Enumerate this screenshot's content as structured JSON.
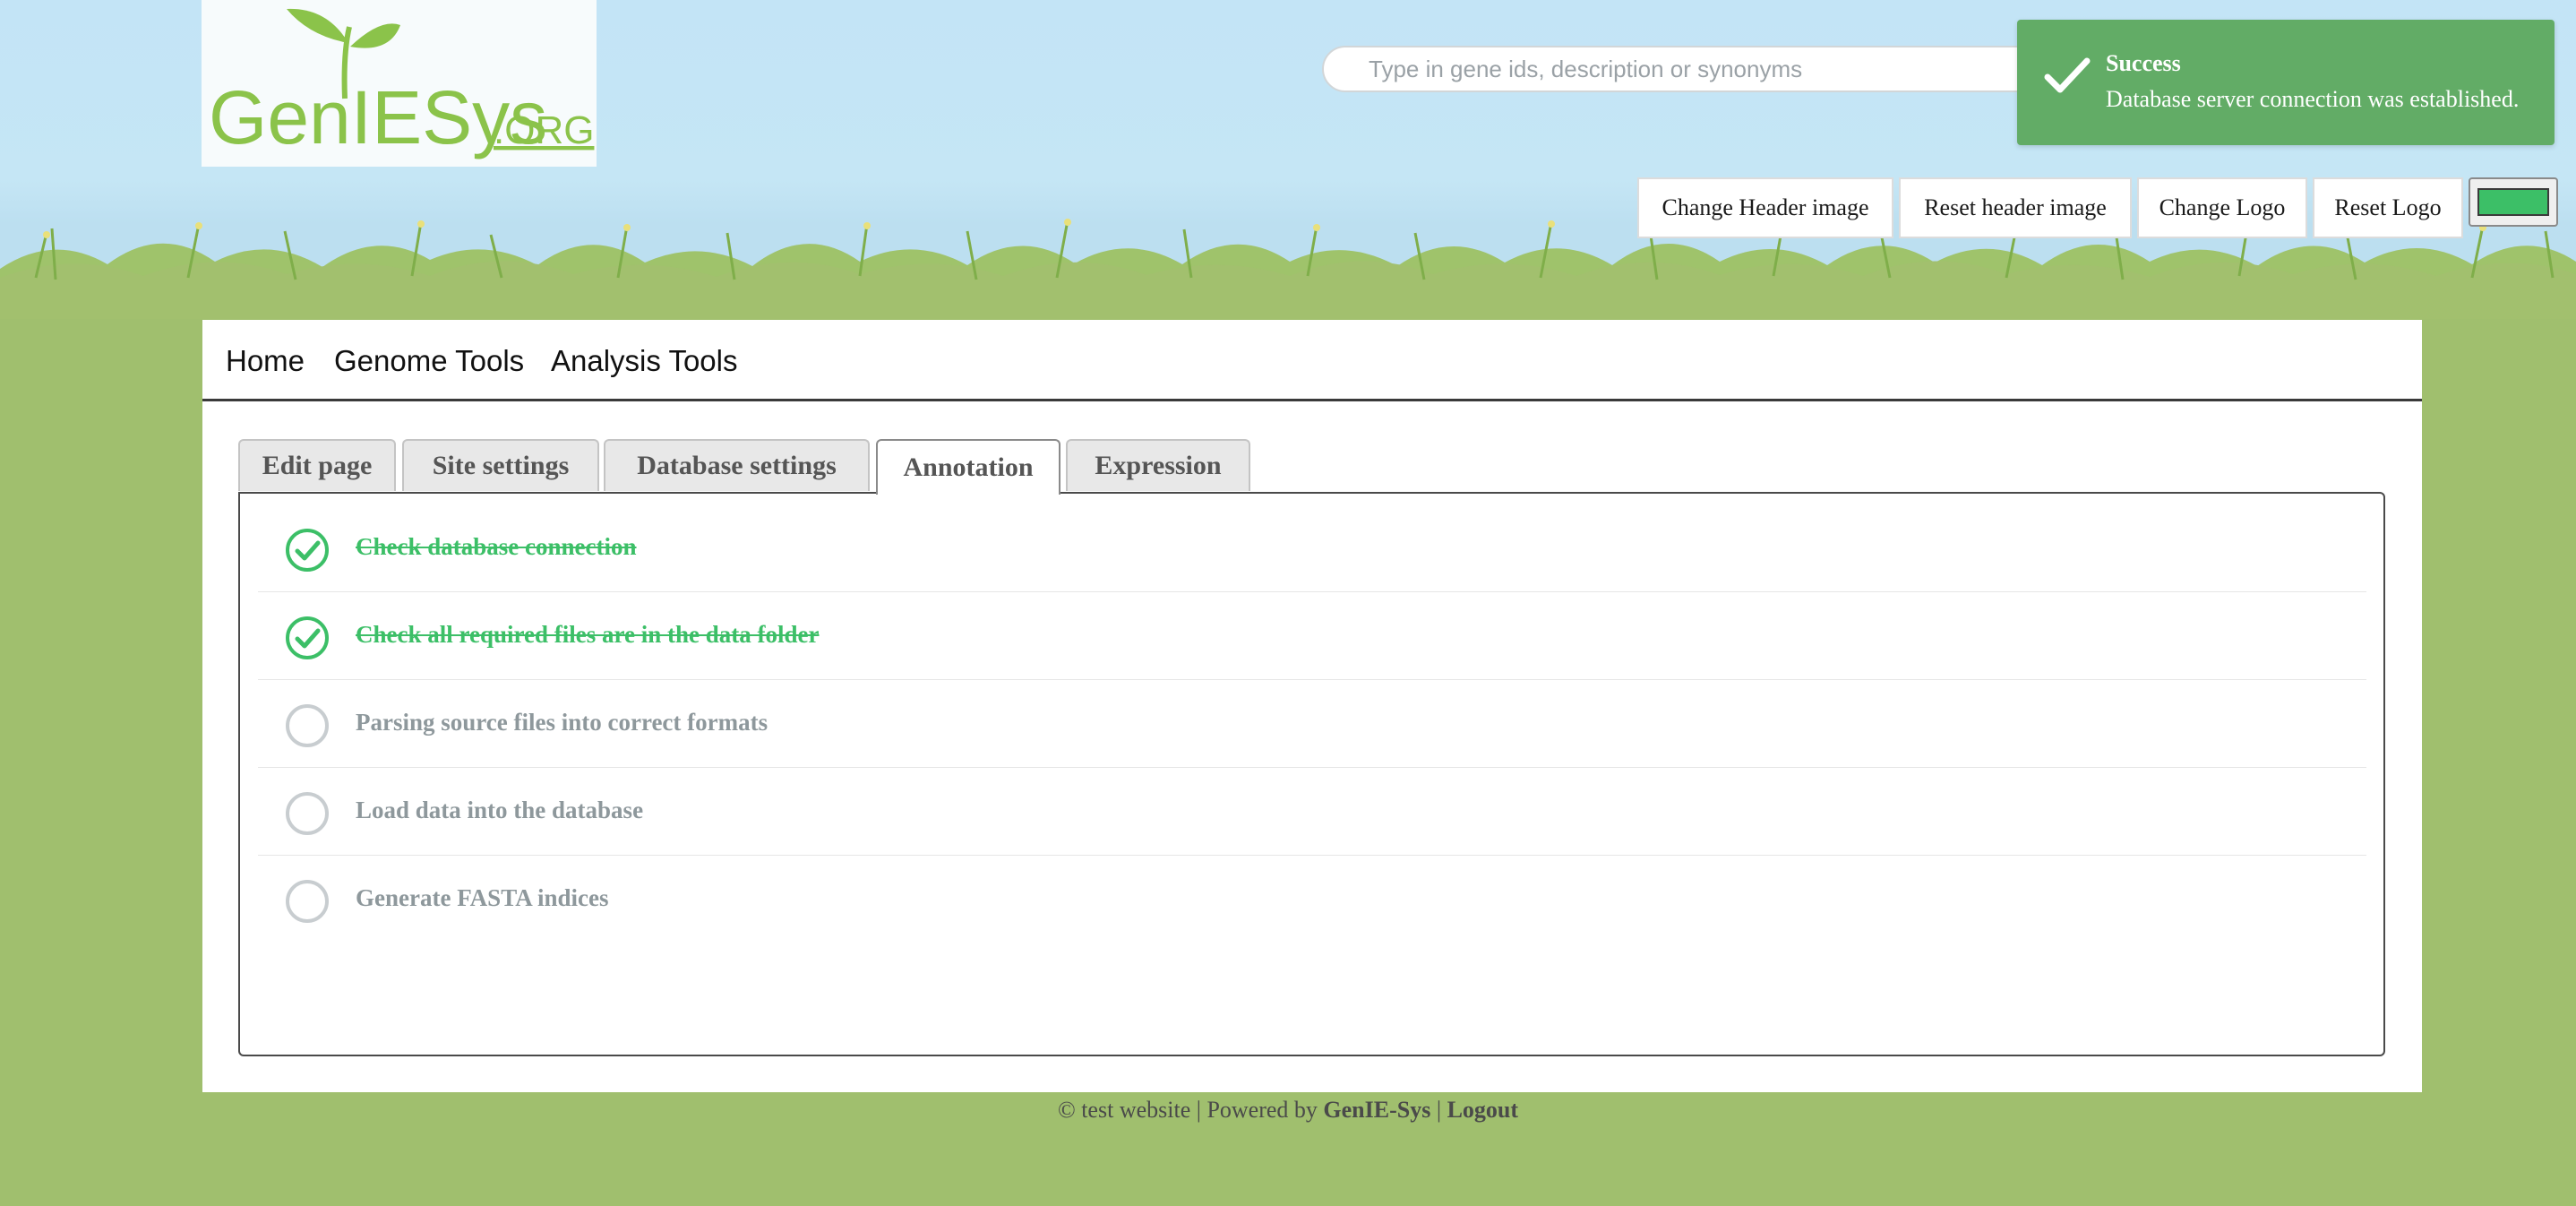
{
  "logo": {
    "text_main": "GenIESys",
    "text_suffix": ".ORG"
  },
  "search": {
    "placeholder": "Type in gene ids, description or synonyms",
    "value": ""
  },
  "header_buttons": {
    "change_header_image": "Change Header image",
    "reset_header_image": "Reset header image",
    "change_logo": "Change Logo",
    "reset_logo": "Reset Logo"
  },
  "color_picker": {
    "value": "#3cbf67"
  },
  "toast": {
    "title": "Success",
    "message": "Database server connection was established."
  },
  "nav": {
    "items": [
      "Home",
      "Genome Tools",
      "Analysis Tools"
    ]
  },
  "tabs": {
    "items": [
      "Edit page",
      "Site settings",
      "Database settings",
      "Annotation",
      "Expression"
    ],
    "active": "Annotation"
  },
  "steps": [
    {
      "label": "Check database connection",
      "status": "done"
    },
    {
      "label": "Check all required files are in the data folder",
      "status": "done"
    },
    {
      "label": "Parsing source files into correct formats",
      "status": "pending"
    },
    {
      "label": "Load data into the database",
      "status": "pending"
    },
    {
      "label": "Generate FASTA indices",
      "status": "pending"
    }
  ],
  "footer": {
    "prefix": "© test website | Powered by ",
    "brand": "GenIE-Sys",
    "separator": " | ",
    "logout": "Logout"
  },
  "colors": {
    "accent_green": "#3cbf67",
    "toast_green": "#62ac66",
    "page_green": "#a0bf6e",
    "sky_blue": "#c3e4f6",
    "pending_gray": "#8e989c"
  }
}
